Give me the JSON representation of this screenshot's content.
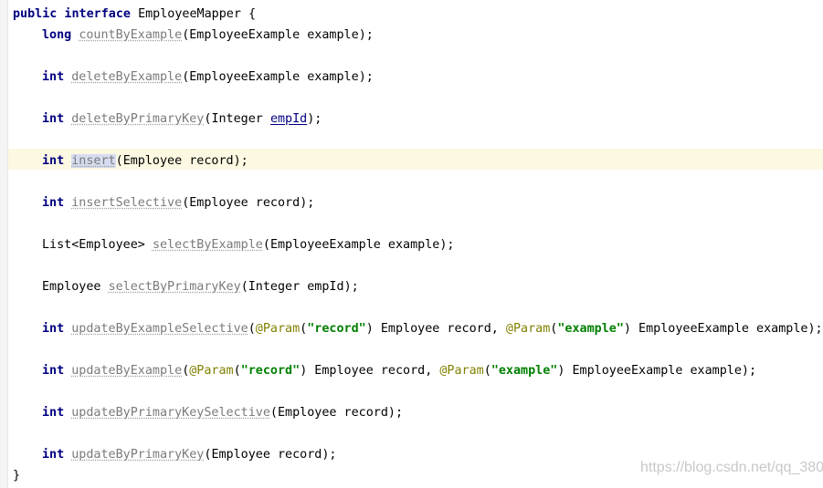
{
  "editor": {
    "decl": {
      "mods": "public interface",
      "name": "EmployeeMapper",
      "open": "{"
    },
    "closing": "}",
    "lines": [
      {
        "ret": "long",
        "method": "countByExample",
        "lp": "(",
        "args": "EmployeeExample example",
        "end": ");"
      },
      {
        "ret": "int",
        "method": "deleteByExample",
        "lp": "(",
        "args": "EmployeeExample example",
        "end": ");"
      },
      {
        "ret": "int",
        "method": "deleteByPrimaryKey",
        "lp": "(",
        "argType": "Integer ",
        "argName": "empId",
        "end": ");"
      },
      {
        "ret": "int",
        "method": "insert",
        "lp": "(",
        "args": "Employee record",
        "end": ");"
      },
      {
        "ret": "int",
        "method": "insertSelective",
        "lp": "(",
        "args": "Employee record",
        "end": ");"
      },
      {
        "ret": "List<Employee>",
        "method": "selectByExample",
        "lp": "(",
        "args": "EmployeeExample example",
        "end": ");"
      },
      {
        "ret": "Employee",
        "method": "selectByPrimaryKey",
        "lp": "(",
        "args": "Integer empId",
        "end": ");"
      },
      {
        "ret": "int",
        "method": "updateByExampleSelective",
        "lp": "(",
        "ann1": "@Param",
        "lp2": "(",
        "str1": "\"record\"",
        "mid1": ") Employee record, ",
        "ann2": "@Param",
        "lp3": "(",
        "str2": "\"example\"",
        "end": ") EmployeeExample example);"
      },
      {
        "ret": "int",
        "method": "updateByExample",
        "lp": "(",
        "ann1": "@Param",
        "lp2": "(",
        "str1": "\"record\"",
        "mid1": ") Employee record, ",
        "ann2": "@Param",
        "lp3": "(",
        "str2": "\"example\"",
        "end": ") EmployeeExample example);"
      },
      {
        "ret": "int",
        "method": "updateByPrimaryKeySelective",
        "lp": "(",
        "args": "Employee record",
        "end": ");"
      },
      {
        "ret": "int",
        "method": "updateByPrimaryKey",
        "lp": "(",
        "args": "Employee record",
        "end": ");"
      }
    ]
  },
  "watermark": "https://blog.csdn.net/qq_380",
  "colors": {
    "keyword": "#000080",
    "method": "#7a7a7a",
    "annotation": "#808000",
    "string": "#008000",
    "caret_line": "#fcf8e1",
    "selection": "#d6dcf0"
  }
}
